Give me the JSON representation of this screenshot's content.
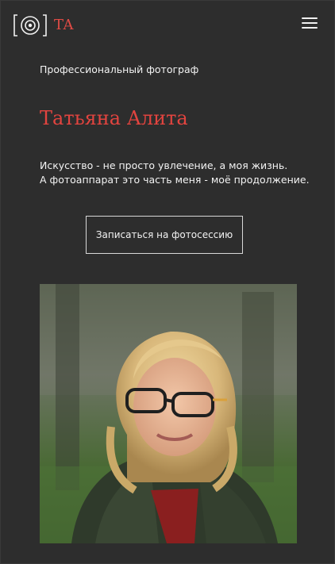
{
  "header": {
    "logo_text": "TA",
    "logo_icon": "camera-lens-icon",
    "menu_icon": "hamburger-menu-icon"
  },
  "hero": {
    "subtitle": "Профессиональный фотограф",
    "name": "Татьяна Алита",
    "intro_line_1": "Искусство - не просто увлечение, а моя жизнь.",
    "intro_line_2": "А фотоаппарат это часть меня - моё продолжение.",
    "cta_label": "Записаться на фотосессию"
  },
  "colors": {
    "background": "#2d2d2d",
    "accent": "#e2443f",
    "text": "#f3f3f3"
  }
}
